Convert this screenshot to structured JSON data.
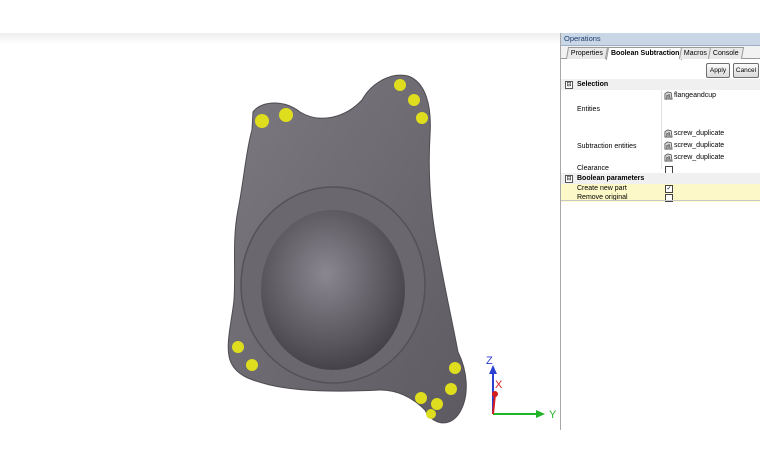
{
  "panel": {
    "title": "Operations",
    "tabs": [
      "Properties",
      "Boolean Subtraction",
      "Macros",
      "Console"
    ],
    "active_tab": "Boolean Subtraction",
    "apply_label": "Apply",
    "cancel_label": "Cancel",
    "sections": {
      "selection": "Selection",
      "boolean": "Boolean parameters"
    },
    "expander_symbol": "⊟",
    "rows": {
      "entities_label": "Entities",
      "entities_value": "flangeandcup",
      "subtraction_label": "Subtraction entities",
      "subtraction_values": [
        "screw_duplicate",
        "screw_duplicate",
        "screw_duplicate"
      ],
      "clearance_label": "Clearance",
      "clearance_checked": false,
      "create_new_part_label": "Create new part",
      "create_new_part_checked": true,
      "remove_original_label": "Remove original",
      "remove_original_checked": false
    }
  },
  "axes": {
    "z": "Z",
    "x": "X",
    "y": "Y"
  },
  "colors": {
    "model": "#6f6c73",
    "screw_marker": "#dede1e",
    "axis_z": "#2b3fd0",
    "axis_x": "#d81c1c",
    "axis_y": "#22b428"
  }
}
